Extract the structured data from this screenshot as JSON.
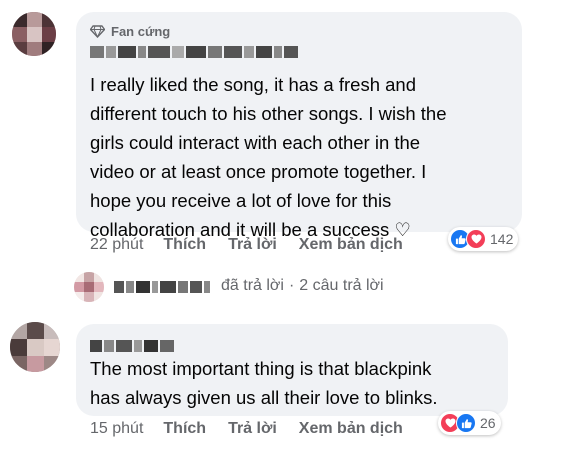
{
  "comment1": {
    "badge": "Fan cứng",
    "text": "I really liked the song, it has a fresh and\ndifferent touch to his other songs. I wish the\ngirls could interact with each other in the\nvideo or at least once promote together. I\nhope you receive a lot of love for this\ncollaboration and it will be a success ♡",
    "time": "22 phút",
    "like": "Thích",
    "reply": "Trả lời",
    "translate": "Xem bản dịch",
    "reaction_count": "142"
  },
  "replies": {
    "replied_text": "đã trả lời",
    "separator": "·",
    "count_text": "2 câu trả lời"
  },
  "comment2": {
    "text": "The most important thing is that blackpink\nhas always given us all their love to blinks.",
    "time": "15 phút",
    "like": "Thích",
    "reply": "Trả lời",
    "translate": "Xem bản dịch",
    "reaction_count": "26"
  },
  "colors": {
    "bubble": "#f0f2f5",
    "secondary_text": "#65676b",
    "like_blue": "#1877f2",
    "love_red": "#f33e58"
  },
  "icons": [
    "diamond-icon",
    "like-icon",
    "love-icon"
  ]
}
